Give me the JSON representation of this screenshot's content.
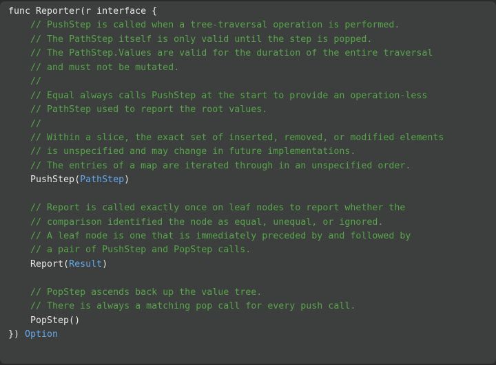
{
  "code_block": {
    "language": "go",
    "background_color": "#3d3e3e",
    "outer_background_color": "#2b2b2b",
    "colors": {
      "text": "#e8e8e8",
      "comment": "#57a64a",
      "type": "#63a9ed"
    },
    "lines": [
      [
        {
          "t": "func Reporter(r interface {",
          "c": "pl"
        }
      ],
      [
        {
          "t": "    ",
          "c": "pl"
        },
        {
          "t": "// PushStep is called when a tree-traversal operation is performed.",
          "c": "cm"
        }
      ],
      [
        {
          "t": "    ",
          "c": "pl"
        },
        {
          "t": "// The PathStep itself is only valid until the step is popped.",
          "c": "cm"
        }
      ],
      [
        {
          "t": "    ",
          "c": "pl"
        },
        {
          "t": "// The PathStep.Values are valid for the duration of the entire traversal",
          "c": "cm"
        }
      ],
      [
        {
          "t": "    ",
          "c": "pl"
        },
        {
          "t": "// and must not be mutated.",
          "c": "cm"
        }
      ],
      [
        {
          "t": "    ",
          "c": "pl"
        },
        {
          "t": "//",
          "c": "cm"
        }
      ],
      [
        {
          "t": "    ",
          "c": "pl"
        },
        {
          "t": "// Equal always calls PushStep at the start to provide an operation-less",
          "c": "cm"
        }
      ],
      [
        {
          "t": "    ",
          "c": "pl"
        },
        {
          "t": "// PathStep used to report the root values.",
          "c": "cm"
        }
      ],
      [
        {
          "t": "    ",
          "c": "pl"
        },
        {
          "t": "//",
          "c": "cm"
        }
      ],
      [
        {
          "t": "    ",
          "c": "pl"
        },
        {
          "t": "// Within a slice, the exact set of inserted, removed, or modified elements",
          "c": "cm"
        }
      ],
      [
        {
          "t": "    ",
          "c": "pl"
        },
        {
          "t": "// is unspecified and may change in future implementations.",
          "c": "cm"
        }
      ],
      [
        {
          "t": "    ",
          "c": "pl"
        },
        {
          "t": "// The entries of a map are iterated through in an unspecified order.",
          "c": "cm"
        }
      ],
      [
        {
          "t": "    PushStep(",
          "c": "pl"
        },
        {
          "t": "PathStep",
          "c": "ty"
        },
        {
          "t": ")",
          "c": "pl"
        }
      ],
      [
        {
          "t": "",
          "c": "pl"
        }
      ],
      [
        {
          "t": "    ",
          "c": "pl"
        },
        {
          "t": "// Report is called exactly once on leaf nodes to report whether the",
          "c": "cm"
        }
      ],
      [
        {
          "t": "    ",
          "c": "pl"
        },
        {
          "t": "// comparison identified the node as equal, unequal, or ignored.",
          "c": "cm"
        }
      ],
      [
        {
          "t": "    ",
          "c": "pl"
        },
        {
          "t": "// A leaf node is one that is immediately preceded by and followed by",
          "c": "cm"
        }
      ],
      [
        {
          "t": "    ",
          "c": "pl"
        },
        {
          "t": "// a pair of PushStep and PopStep calls.",
          "c": "cm"
        }
      ],
      [
        {
          "t": "    Report(",
          "c": "pl"
        },
        {
          "t": "Result",
          "c": "ty"
        },
        {
          "t": ")",
          "c": "pl"
        }
      ],
      [
        {
          "t": "",
          "c": "pl"
        }
      ],
      [
        {
          "t": "    ",
          "c": "pl"
        },
        {
          "t": "// PopStep ascends back up the value tree.",
          "c": "cm"
        }
      ],
      [
        {
          "t": "    ",
          "c": "pl"
        },
        {
          "t": "// There is always a matching pop call for every push call.",
          "c": "cm"
        }
      ],
      [
        {
          "t": "    PopStep()",
          "c": "pl"
        }
      ],
      [
        {
          "t": "}) ",
          "c": "pl"
        },
        {
          "t": "Option",
          "c": "ty"
        }
      ]
    ]
  }
}
